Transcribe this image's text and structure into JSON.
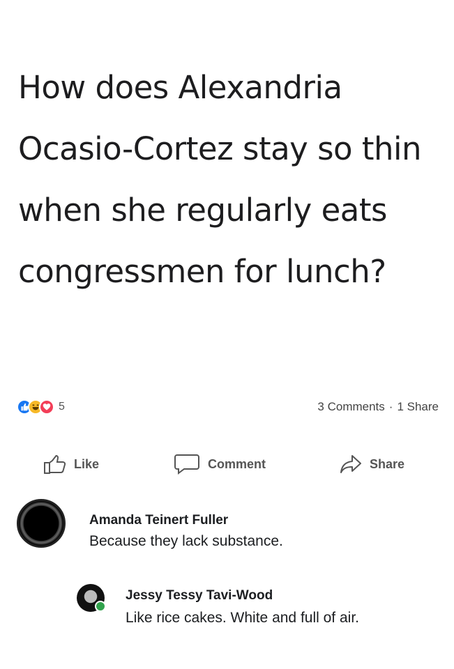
{
  "post": {
    "text": "How does Alexandria Ocasio-Cortez stay so thin when she regularly eats congressmen for lunch?"
  },
  "stats": {
    "reaction_count": "5",
    "comments": "3 Comments",
    "separator": "·",
    "shares": "1 Share",
    "reaction_icons": [
      "like-icon",
      "haha-icon",
      "love-icon"
    ]
  },
  "actions": {
    "like": "Like",
    "comment": "Comment",
    "share": "Share"
  },
  "comments": [
    {
      "name": "Amanda Teinert Fuller",
      "text": "Because they lack substance."
    },
    {
      "name": "Jessy Tessy Tavi-Wood",
      "text": "Like rice cakes. White and full of air."
    }
  ],
  "colors": {
    "like_blue": "#1877f2",
    "haha_yellow": "#f7b928",
    "love_red": "#f33e58",
    "online_green": "#31a24c"
  }
}
